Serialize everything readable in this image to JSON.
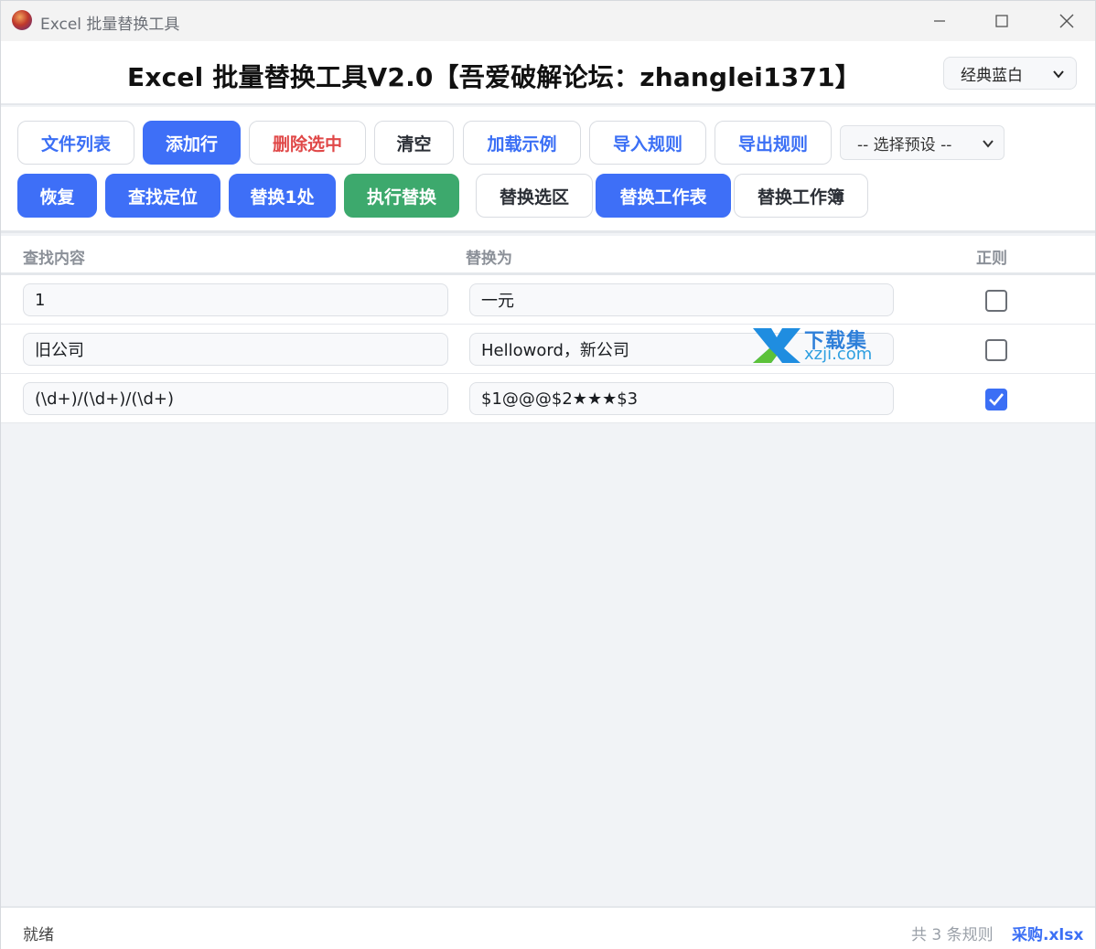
{
  "window": {
    "title": "Excel 批量替换工具"
  },
  "header": {
    "title": "Excel 批量替换工具V2.0【吾爱破解论坛：zhanglei1371】",
    "theme_select": "经典蓝白"
  },
  "toolbar": {
    "row1": [
      {
        "label": "文件列表",
        "style": "outline"
      },
      {
        "label": "添加行",
        "style": "primary"
      },
      {
        "label": "删除选中",
        "style": "outline-red"
      },
      {
        "label": "清空",
        "style": "outline-dark"
      },
      {
        "label": "加载示例",
        "style": "outline"
      },
      {
        "label": "导入规则",
        "style": "outline"
      },
      {
        "label": "导出规则",
        "style": "outline"
      }
    ],
    "preset_select": "-- 选择预设 --",
    "row2": [
      {
        "label": "恢复",
        "style": "primary"
      },
      {
        "label": "查找定位",
        "style": "primary"
      },
      {
        "label": "替换1处",
        "style": "primary"
      },
      {
        "label": "执行替换",
        "style": "green"
      },
      {
        "label": "替换选区",
        "style": "outline-dark"
      },
      {
        "label": "替换工作表",
        "style": "primary"
      },
      {
        "label": "替换工作簿",
        "style": "outline-dark"
      }
    ]
  },
  "table": {
    "headers": {
      "find": "查找内容",
      "replace": "替换为",
      "regex": "正则"
    },
    "rows": [
      {
        "find": "1",
        "replace": "一元",
        "regex": false
      },
      {
        "find": "旧公司",
        "replace": "Helloword，新公司",
        "regex": false
      },
      {
        "find": "(\\d+)/(\\d+)/(\\d+)",
        "replace": "$1@@@$2★★★$3",
        "regex": true
      }
    ]
  },
  "watermark": {
    "top": "下载集",
    "bottom": "xzji.com"
  },
  "statusbar": {
    "status": "就绪",
    "rule_count": "共 3 条规则",
    "file": "采购.xlsx"
  },
  "colors": {
    "primary": "#3e6ff7",
    "green": "#3da96d",
    "danger": "#e04848"
  }
}
